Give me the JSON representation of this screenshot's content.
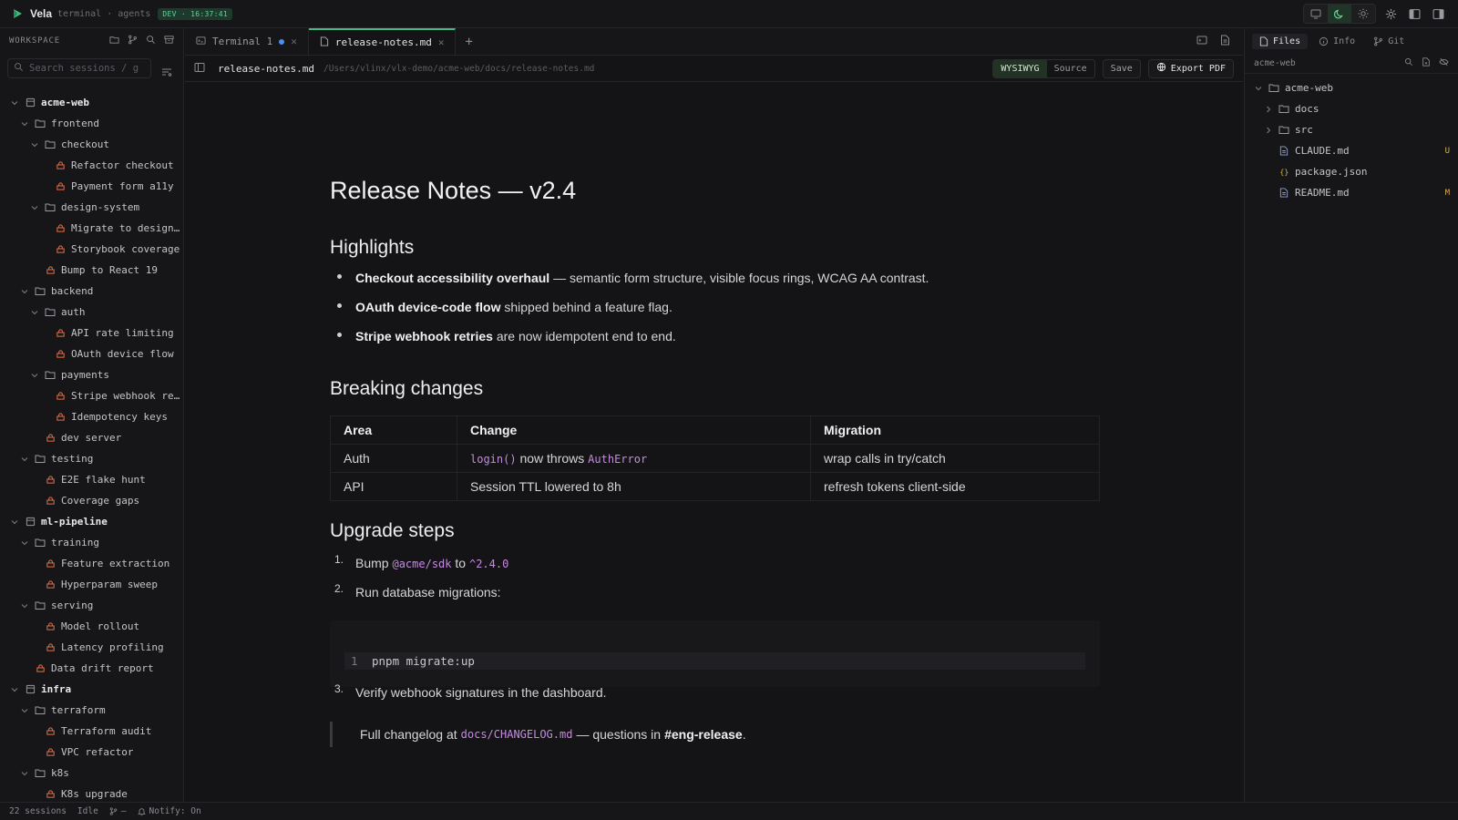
{
  "topbar": {
    "app": "Vela",
    "subtitle": "terminal · agents",
    "env_badge": "DEV · 16:37:41"
  },
  "sidebar": {
    "header": "WORKSPACE",
    "search_placeholder": "Search sessions / g...",
    "tree": [
      {
        "label": "acme-web",
        "kind": "repo",
        "depth": 0
      },
      {
        "label": "frontend",
        "kind": "folder",
        "depth": 1
      },
      {
        "label": "checkout",
        "kind": "folder",
        "depth": 2
      },
      {
        "label": "Refactor checkout",
        "kind": "session",
        "depth": 3
      },
      {
        "label": "Payment form a11y",
        "kind": "session",
        "depth": 3
      },
      {
        "label": "design-system",
        "kind": "folder",
        "depth": 2
      },
      {
        "label": "Migrate to design tokens",
        "kind": "session",
        "depth": 3
      },
      {
        "label": "Storybook coverage",
        "kind": "session",
        "depth": 3
      },
      {
        "label": "Bump to React 19",
        "kind": "session",
        "depth": 2
      },
      {
        "label": "backend",
        "kind": "folder",
        "depth": 1
      },
      {
        "label": "auth",
        "kind": "folder",
        "depth": 2
      },
      {
        "label": "API rate limiting",
        "kind": "session",
        "depth": 3
      },
      {
        "label": "OAuth device flow",
        "kind": "session",
        "depth": 3
      },
      {
        "label": "payments",
        "kind": "folder",
        "depth": 2
      },
      {
        "label": "Stripe webhook retries",
        "kind": "session",
        "depth": 3
      },
      {
        "label": "Idempotency keys",
        "kind": "session",
        "depth": 3
      },
      {
        "label": "dev server",
        "kind": "session",
        "depth": 2
      },
      {
        "label": "testing",
        "kind": "folder",
        "depth": 1
      },
      {
        "label": "E2E flake hunt",
        "kind": "session",
        "depth": 2
      },
      {
        "label": "Coverage gaps",
        "kind": "session",
        "depth": 2
      },
      {
        "label": "ml-pipeline",
        "kind": "repo",
        "depth": 0
      },
      {
        "label": "training",
        "kind": "folder",
        "depth": 1
      },
      {
        "label": "Feature extraction",
        "kind": "session",
        "depth": 2
      },
      {
        "label": "Hyperparam sweep",
        "kind": "session",
        "depth": 2
      },
      {
        "label": "serving",
        "kind": "folder",
        "depth": 1
      },
      {
        "label": "Model rollout",
        "kind": "session",
        "depth": 2
      },
      {
        "label": "Latency profiling",
        "kind": "session",
        "depth": 2
      },
      {
        "label": "Data drift report",
        "kind": "session",
        "depth": 1
      },
      {
        "label": "infra",
        "kind": "repo",
        "depth": 0
      },
      {
        "label": "terraform",
        "kind": "folder",
        "depth": 1
      },
      {
        "label": "Terraform audit",
        "kind": "session",
        "depth": 2
      },
      {
        "label": "VPC refactor",
        "kind": "session",
        "depth": 2
      },
      {
        "label": "k8s",
        "kind": "folder",
        "depth": 1
      },
      {
        "label": "K8s upgrade",
        "kind": "session",
        "depth": 2
      }
    ]
  },
  "tabs": [
    {
      "label": "Terminal 1",
      "icon": "terminal-icon",
      "active": false,
      "dirty": true
    },
    {
      "label": "release-notes.md",
      "icon": "file-icon",
      "active": true,
      "dirty": false
    }
  ],
  "pathbar": {
    "filename": "release-notes.md",
    "path": "/Users/vlinx/vlx-demo/acme-web/docs/release-notes.md",
    "mode_wysiwyg": "WYSIWYG",
    "mode_source": "Source",
    "save": "Save",
    "export_pdf": "Export PDF"
  },
  "doc": {
    "title": "Release Notes — v2.4",
    "h_highlights": "Highlights",
    "highlights": [
      {
        "bold": "Checkout accessibility overhaul",
        "rest": " — semantic form structure, visible focus rings, WCAG AA contrast."
      },
      {
        "bold": "OAuth device-code flow",
        "rest": " shipped behind a feature flag."
      },
      {
        "bold": "Stripe webhook retries",
        "rest": " are now idempotent end to end."
      }
    ],
    "h_breaking": "Breaking changes",
    "table": {
      "headers": [
        "Area",
        "Change",
        "Migration"
      ],
      "rows": [
        {
          "area": "Auth",
          "code1": "login()",
          "mid": " now throws ",
          "code2": "AuthError",
          "migration": "wrap calls in try/catch"
        },
        {
          "area": "API",
          "change": "Session TTL lowered to 8h",
          "migration": "refresh tokens client-side"
        }
      ]
    },
    "h_upgrade": "Upgrade steps",
    "steps": {
      "s1_pre": "Bump ",
      "s1_code1": "@acme/sdk",
      "s1_mid": " to ",
      "s1_code2": "^2.4.0",
      "s2": "Run database migrations:",
      "s3": "Verify webhook signatures in the dashboard."
    },
    "code": {
      "line_no": "1",
      "command": "pnpm migrate:up"
    },
    "quote": {
      "pre": "Full changelog at ",
      "code": "docs/CHANGELOG.md",
      "mid": " — questions in ",
      "bold": "#eng-release",
      "post": "."
    }
  },
  "right": {
    "tabs": [
      "Files",
      "Info",
      "Git"
    ],
    "root_label": "acme-web",
    "files": [
      {
        "label": "acme-web",
        "kind": "folder-open",
        "depth": 0,
        "status": ""
      },
      {
        "label": "docs",
        "kind": "folder",
        "depth": 1,
        "status": ""
      },
      {
        "label": "src",
        "kind": "folder",
        "depth": 1,
        "status": ""
      },
      {
        "label": "CLAUDE.md",
        "kind": "file",
        "depth": 1,
        "status": "U"
      },
      {
        "label": "package.json",
        "kind": "json",
        "depth": 1,
        "status": ""
      },
      {
        "label": "README.md",
        "kind": "file",
        "depth": 1,
        "status": "M"
      }
    ]
  },
  "status": {
    "sessions": "22 sessions",
    "state": "Idle",
    "branch": "—",
    "notify": "Notify: On"
  },
  "colors": {
    "accent": "#3dbd83",
    "session_icon": "#e0714a",
    "code": "#c58be0",
    "untracked": "#d8b24a",
    "modified": "#e0a84a"
  }
}
